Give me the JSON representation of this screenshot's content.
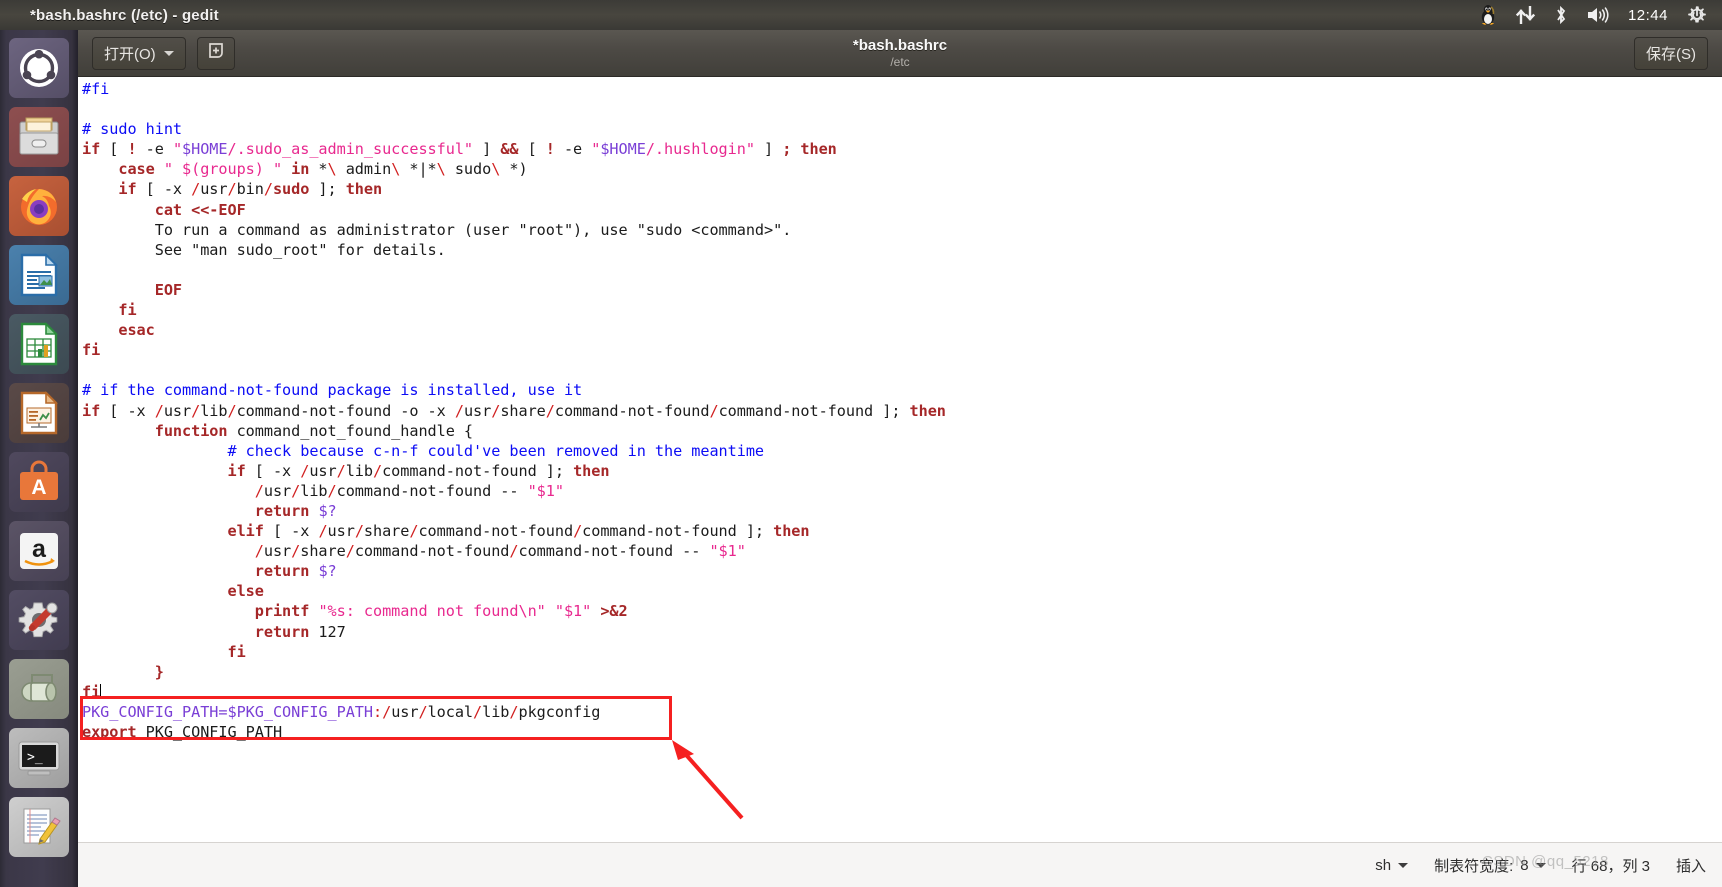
{
  "window": {
    "title": "*bash.bashrc (/etc) - gedit"
  },
  "topbar": {
    "clock": "12:44",
    "tray_icons": [
      "tux-penguin-icon",
      "network-updown-icon",
      "bluetooth-icon",
      "volume-icon",
      "power-gear-icon"
    ]
  },
  "launcher": {
    "items": [
      {
        "name": "ubuntu-dash",
        "label": "Ubuntu",
        "running": false
      },
      {
        "name": "files",
        "label": "Files",
        "running": true
      },
      {
        "name": "firefox",
        "label": "Firefox",
        "running": true
      },
      {
        "name": "libreoffice-writer",
        "label": "LibreOffice Writer",
        "running": true
      },
      {
        "name": "libreoffice-calc",
        "label": "LibreOffice Calc",
        "running": false
      },
      {
        "name": "libreoffice-impress",
        "label": "LibreOffice Impress",
        "running": false
      },
      {
        "name": "ubuntu-software",
        "label": "Ubuntu Software",
        "running": false
      },
      {
        "name": "amazon",
        "label": "Amazon",
        "running": false
      },
      {
        "name": "system-settings",
        "label": "System Settings",
        "running": false
      },
      {
        "name": "archive-manager",
        "label": "Archive Manager",
        "running": true
      },
      {
        "name": "terminal",
        "label": "Terminal",
        "running": true
      },
      {
        "name": "gedit",
        "label": "Text Editor",
        "running": true
      }
    ]
  },
  "headerbar": {
    "open_label": "打开(O)",
    "new_icon": "new-document-icon",
    "title": "*bash.bashrc",
    "subtitle": "/etc",
    "save_label": "保存(S)"
  },
  "statusbar": {
    "language": "sh",
    "tab_width_label": "制表符宽度:",
    "tab_width_value": "8",
    "position": "行 68，列 3",
    "insert_mode": "插入"
  },
  "watermark": {
    "text": "CSDN @qq_5218"
  },
  "annotation": {
    "box_color": "#f52020",
    "arrow_color": "#f52020"
  },
  "colors": {
    "comment": "#0c0cf5",
    "keyword": "#a52728",
    "string": "#e8298f",
    "variable": "#7a3fd6",
    "slash": "#d12121",
    "text": "#1b1b1b",
    "editor_bg": "#ffffff",
    "headerbar_bg": "#4d4a45",
    "topbar_bg": "#3c3b37"
  },
  "editor": {
    "filename": "bash.bashrc",
    "modified": true,
    "lines": [
      [
        {
          "t": "#fi",
          "c": "cmt"
        }
      ],
      [],
      [
        {
          "t": "# sudo hint",
          "c": "cmt"
        }
      ],
      [
        {
          "t": "if",
          "c": "kw"
        },
        {
          "t": " [ ",
          "c": "plain"
        },
        {
          "t": "!",
          "c": "kw"
        },
        {
          "t": " -e ",
          "c": "plain"
        },
        {
          "t": "\"",
          "c": "str"
        },
        {
          "t": "$HOME",
          "c": "var"
        },
        {
          "t": "/.sudo_as_admin_successful\"",
          "c": "str"
        },
        {
          "t": " ] ",
          "c": "plain"
        },
        {
          "t": "&&",
          "c": "kw"
        },
        {
          "t": " [ ",
          "c": "plain"
        },
        {
          "t": "!",
          "c": "kw"
        },
        {
          "t": " -e ",
          "c": "plain"
        },
        {
          "t": "\"",
          "c": "str"
        },
        {
          "t": "$HOME",
          "c": "var"
        },
        {
          "t": "/.hushlogin\"",
          "c": "str"
        },
        {
          "t": " ] ",
          "c": "plain"
        },
        {
          "t": ";",
          "c": "kw"
        },
        {
          "t": " ",
          "c": "plain"
        },
        {
          "t": "then",
          "c": "kw"
        }
      ],
      [
        {
          "t": "    ",
          "c": "plain"
        },
        {
          "t": "case",
          "c": "kw"
        },
        {
          "t": " ",
          "c": "plain"
        },
        {
          "t": "\" $(groups) \"",
          "c": "str"
        },
        {
          "t": " ",
          "c": "plain"
        },
        {
          "t": "in",
          "c": "kw"
        },
        {
          "t": " *",
          "c": "plain"
        },
        {
          "t": "\\",
          "c": "sl"
        },
        {
          "t": " admin",
          "c": "plain"
        },
        {
          "t": "\\",
          "c": "sl"
        },
        {
          "t": " *|*",
          "c": "plain"
        },
        {
          "t": "\\",
          "c": "sl"
        },
        {
          "t": " sudo",
          "c": "plain"
        },
        {
          "t": "\\",
          "c": "sl"
        },
        {
          "t": " *)",
          "c": "plain"
        }
      ],
      [
        {
          "t": "    ",
          "c": "plain"
        },
        {
          "t": "if",
          "c": "kw"
        },
        {
          "t": " [ -x ",
          "c": "plain"
        },
        {
          "t": "/",
          "c": "sl"
        },
        {
          "t": "usr",
          "c": "pth"
        },
        {
          "t": "/",
          "c": "sl"
        },
        {
          "t": "bin",
          "c": "pth"
        },
        {
          "t": "/",
          "c": "sl"
        },
        {
          "t": "sudo",
          "c": "kw"
        },
        {
          "t": " ]; ",
          "c": "plain"
        },
        {
          "t": "then",
          "c": "kw"
        }
      ],
      [
        {
          "t": "        ",
          "c": "plain"
        },
        {
          "t": "cat <<-EOF",
          "c": "kw"
        }
      ],
      [
        {
          "t": "        To run a command as administrator (user \"root\"), use \"sudo <command>\".",
          "c": "plain"
        }
      ],
      [
        {
          "t": "        See \"man sudo_root\" for details.",
          "c": "plain"
        }
      ],
      [],
      [
        {
          "t": "        ",
          "c": "plain"
        },
        {
          "t": "EOF",
          "c": "kw"
        }
      ],
      [
        {
          "t": "    ",
          "c": "plain"
        },
        {
          "t": "fi",
          "c": "kw"
        }
      ],
      [
        {
          "t": "    ",
          "c": "plain"
        },
        {
          "t": "esac",
          "c": "kw"
        }
      ],
      [
        {
          "t": "fi",
          "c": "kw"
        }
      ],
      [],
      [
        {
          "t": "# if the command-not-found package is installed, use it",
          "c": "cmt"
        }
      ],
      [
        {
          "t": "if",
          "c": "kw"
        },
        {
          "t": " [ -x ",
          "c": "plain"
        },
        {
          "t": "/",
          "c": "sl"
        },
        {
          "t": "usr",
          "c": "pth"
        },
        {
          "t": "/",
          "c": "sl"
        },
        {
          "t": "lib",
          "c": "pth"
        },
        {
          "t": "/",
          "c": "sl"
        },
        {
          "t": "command-not-found",
          "c": "pth"
        },
        {
          "t": " -o -x ",
          "c": "plain"
        },
        {
          "t": "/",
          "c": "sl"
        },
        {
          "t": "usr",
          "c": "pth"
        },
        {
          "t": "/",
          "c": "sl"
        },
        {
          "t": "share",
          "c": "pth"
        },
        {
          "t": "/",
          "c": "sl"
        },
        {
          "t": "command-not-found",
          "c": "pth"
        },
        {
          "t": "/",
          "c": "sl"
        },
        {
          "t": "command-not-found",
          "c": "pth"
        },
        {
          "t": " ]; ",
          "c": "plain"
        },
        {
          "t": "then",
          "c": "kw"
        }
      ],
      [
        {
          "t": "        ",
          "c": "plain"
        },
        {
          "t": "function",
          "c": "kw"
        },
        {
          "t": " command_not_found_handle {",
          "c": "plain"
        }
      ],
      [
        {
          "t": "                ",
          "c": "plain"
        },
        {
          "t": "# check because c-n-f could've been removed in the meantime",
          "c": "cmt"
        }
      ],
      [
        {
          "t": "                ",
          "c": "plain"
        },
        {
          "t": "if",
          "c": "kw"
        },
        {
          "t": " [ -x ",
          "c": "plain"
        },
        {
          "t": "/",
          "c": "sl"
        },
        {
          "t": "usr",
          "c": "pth"
        },
        {
          "t": "/",
          "c": "sl"
        },
        {
          "t": "lib",
          "c": "pth"
        },
        {
          "t": "/",
          "c": "sl"
        },
        {
          "t": "command-not-found",
          "c": "pth"
        },
        {
          "t": " ]; ",
          "c": "plain"
        },
        {
          "t": "then",
          "c": "kw"
        }
      ],
      [
        {
          "t": "                   ",
          "c": "plain"
        },
        {
          "t": "/",
          "c": "sl"
        },
        {
          "t": "usr",
          "c": "pth"
        },
        {
          "t": "/",
          "c": "sl"
        },
        {
          "t": "lib",
          "c": "pth"
        },
        {
          "t": "/",
          "c": "sl"
        },
        {
          "t": "command-not-found",
          "c": "pth"
        },
        {
          "t": " -- ",
          "c": "plain"
        },
        {
          "t": "\"$1\"",
          "c": "str"
        }
      ],
      [
        {
          "t": "                   ",
          "c": "plain"
        },
        {
          "t": "return",
          "c": "kw"
        },
        {
          "t": " ",
          "c": "plain"
        },
        {
          "t": "$?",
          "c": "var"
        }
      ],
      [
        {
          "t": "                ",
          "c": "plain"
        },
        {
          "t": "elif",
          "c": "kw"
        },
        {
          "t": " [ -x ",
          "c": "plain"
        },
        {
          "t": "/",
          "c": "sl"
        },
        {
          "t": "usr",
          "c": "pth"
        },
        {
          "t": "/",
          "c": "sl"
        },
        {
          "t": "share",
          "c": "pth"
        },
        {
          "t": "/",
          "c": "sl"
        },
        {
          "t": "command-not-found",
          "c": "pth"
        },
        {
          "t": "/",
          "c": "sl"
        },
        {
          "t": "command-not-found",
          "c": "pth"
        },
        {
          "t": " ]; ",
          "c": "plain"
        },
        {
          "t": "then",
          "c": "kw"
        }
      ],
      [
        {
          "t": "                   ",
          "c": "plain"
        },
        {
          "t": "/",
          "c": "sl"
        },
        {
          "t": "usr",
          "c": "pth"
        },
        {
          "t": "/",
          "c": "sl"
        },
        {
          "t": "share",
          "c": "pth"
        },
        {
          "t": "/",
          "c": "sl"
        },
        {
          "t": "command-not-found",
          "c": "pth"
        },
        {
          "t": "/",
          "c": "sl"
        },
        {
          "t": "command-not-found",
          "c": "pth"
        },
        {
          "t": " -- ",
          "c": "plain"
        },
        {
          "t": "\"$1\"",
          "c": "str"
        }
      ],
      [
        {
          "t": "                   ",
          "c": "plain"
        },
        {
          "t": "return",
          "c": "kw"
        },
        {
          "t": " ",
          "c": "plain"
        },
        {
          "t": "$?",
          "c": "var"
        }
      ],
      [
        {
          "t": "                ",
          "c": "plain"
        },
        {
          "t": "else",
          "c": "kw"
        }
      ],
      [
        {
          "t": "                   ",
          "c": "plain"
        },
        {
          "t": "printf",
          "c": "kw"
        },
        {
          "t": " ",
          "c": "plain"
        },
        {
          "t": "\"%s: command not found\\n\"",
          "c": "str"
        },
        {
          "t": " ",
          "c": "plain"
        },
        {
          "t": "\"$1\"",
          "c": "str"
        },
        {
          "t": " ",
          "c": "plain"
        },
        {
          "t": ">&2",
          "c": "kw"
        }
      ],
      [
        {
          "t": "                   ",
          "c": "plain"
        },
        {
          "t": "return",
          "c": "kw"
        },
        {
          "t": " 127",
          "c": "plain"
        }
      ],
      [
        {
          "t": "                ",
          "c": "plain"
        },
        {
          "t": "fi",
          "c": "kw"
        }
      ],
      [
        {
          "t": "        ",
          "c": "plain"
        },
        {
          "t": "}",
          "c": "kw"
        }
      ],
      [
        {
          "t": "fi",
          "c": "kw"
        },
        {
          "t": "|CARET|",
          "c": "caretbar"
        }
      ],
      [
        {
          "t": "PKG_CONFIG_PATH=",
          "c": "var"
        },
        {
          "t": "$PKG_CONFIG_PATH",
          "c": "var"
        },
        {
          "t": ":",
          "c": "sl"
        },
        {
          "t": "/",
          "c": "sl"
        },
        {
          "t": "usr",
          "c": "pth"
        },
        {
          "t": "/",
          "c": "sl"
        },
        {
          "t": "local",
          "c": "pth"
        },
        {
          "t": "/",
          "c": "sl"
        },
        {
          "t": "lib",
          "c": "pth"
        },
        {
          "t": "/",
          "c": "sl"
        },
        {
          "t": "pkgconfig",
          "c": "pth"
        }
      ],
      [
        {
          "t": "export",
          "c": "kw"
        },
        {
          "t": " PKG_CONFIG_PATH",
          "c": "plain"
        }
      ]
    ]
  }
}
